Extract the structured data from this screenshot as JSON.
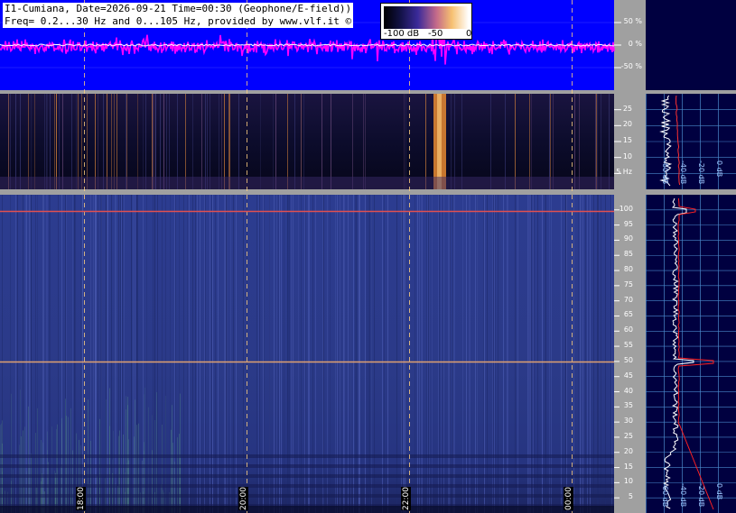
{
  "station": "I1-Cumiana",
  "header": {
    "line1": "I1-Cumiana, Date=2026-09-21 Time=00:30 (Geophone/E-field))",
    "line2": "Freq= 0.2...30 Hz and 0...105 Hz, provided by www.vlf.it ©"
  },
  "colorbar": {
    "labels": [
      "-100 dB",
      "-50",
      "0"
    ]
  },
  "colors": {
    "waveform_bg": "#0000ff",
    "waveform_trace": "#ff00ff",
    "waveform_center": "#ffffff",
    "spectrum_bg": "#0a0c2a",
    "spectrogram_bg": "#2a3a8a",
    "panel_gray": "#a0a0a0",
    "profile_bg": "#000040",
    "grid": "#4a8acb",
    "hour_line": "#ffd080",
    "line_100hz": "#e05050"
  },
  "chart_data": [
    {
      "type": "line",
      "title": "",
      "ylabel": "%",
      "ylim": [
        -100,
        100
      ],
      "yticks": [
        50,
        0,
        -50
      ],
      "ytick_labels": [
        "50 %",
        "0 %",
        "-50 %"
      ],
      "series": [
        {
          "values": []
        }
      ]
    },
    {
      "type": "heatmap",
      "ylim": [
        0,
        30
      ],
      "yticks": [
        25,
        20,
        15,
        10,
        5
      ],
      "ytick_labels": [
        "25",
        "20",
        "15",
        "10",
        "5 Hz"
      ],
      "profile_xticks": [
        "-60 dB",
        "-40 dB",
        "-20 dB",
        "0 dB"
      ]
    },
    {
      "type": "heatmap",
      "ylim": [
        0,
        105
      ],
      "yticks": [
        100,
        95,
        90,
        85,
        80,
        75,
        70,
        65,
        60,
        55,
        50,
        45,
        40,
        35,
        30,
        25,
        20,
        15,
        10,
        5
      ],
      "ytick_labels": [
        "100",
        "95",
        "90",
        "85",
        "80",
        "75",
        "70",
        "65",
        "60",
        "55",
        "50",
        "45",
        "40",
        "35",
        "30",
        "25",
        "20",
        "15",
        "10",
        "5"
      ],
      "profile_xticks": [
        "-60 dB",
        "-40 dB",
        "-20 dB",
        "0 dB"
      ],
      "lines_hz": [
        100,
        50
      ]
    }
  ],
  "hours": [
    "18:00",
    "20:00",
    "22:00",
    "00:00"
  ]
}
